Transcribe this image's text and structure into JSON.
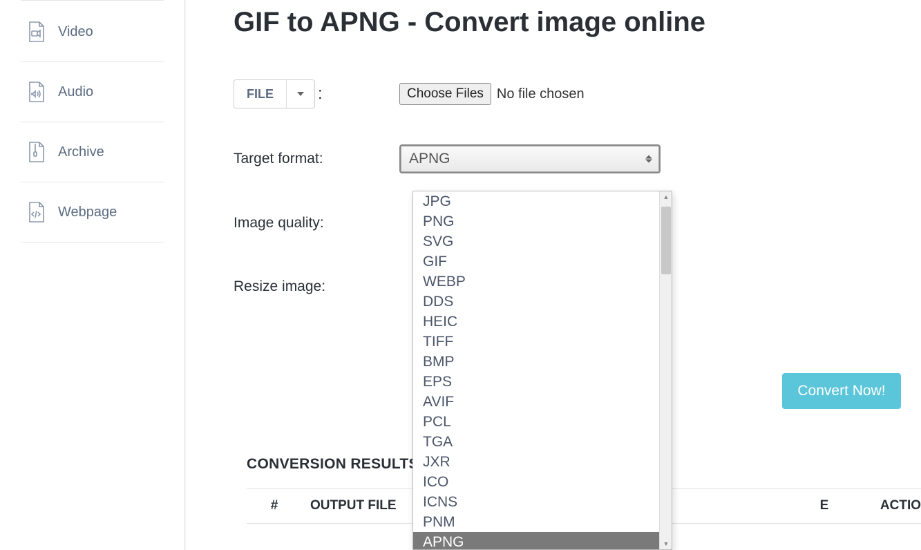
{
  "sidebar": {
    "items": [
      {
        "label": "Video",
        "icon": "video"
      },
      {
        "label": "Audio",
        "icon": "audio"
      },
      {
        "label": "Archive",
        "icon": "archive"
      },
      {
        "label": "Webpage",
        "icon": "webpage"
      }
    ]
  },
  "page": {
    "title": "GIF to APNG - Convert image online"
  },
  "form": {
    "file_button": "FILE",
    "choose_files": "Choose Files",
    "no_file": "No file chosen",
    "target_format_label": "Target format:",
    "target_format_value": "APNG",
    "image_quality_label": "Image quality:",
    "resize_label": "Resize image:",
    "convert_button": "Convert Now!"
  },
  "dropdown": {
    "options": [
      "JPG",
      "PNG",
      "SVG",
      "GIF",
      "WEBP",
      "DDS",
      "HEIC",
      "TIFF",
      "BMP",
      "EPS",
      "AVIF",
      "PCL",
      "TGA",
      "JXR",
      "ICO",
      "ICNS",
      "PNM",
      "APNG"
    ],
    "selected": "APNG"
  },
  "results": {
    "heading": "CONVERSION RESULTS:",
    "columns": {
      "num": "#",
      "output": "OUTPUT FILE",
      "e": "E",
      "action": "ACTIO"
    }
  }
}
